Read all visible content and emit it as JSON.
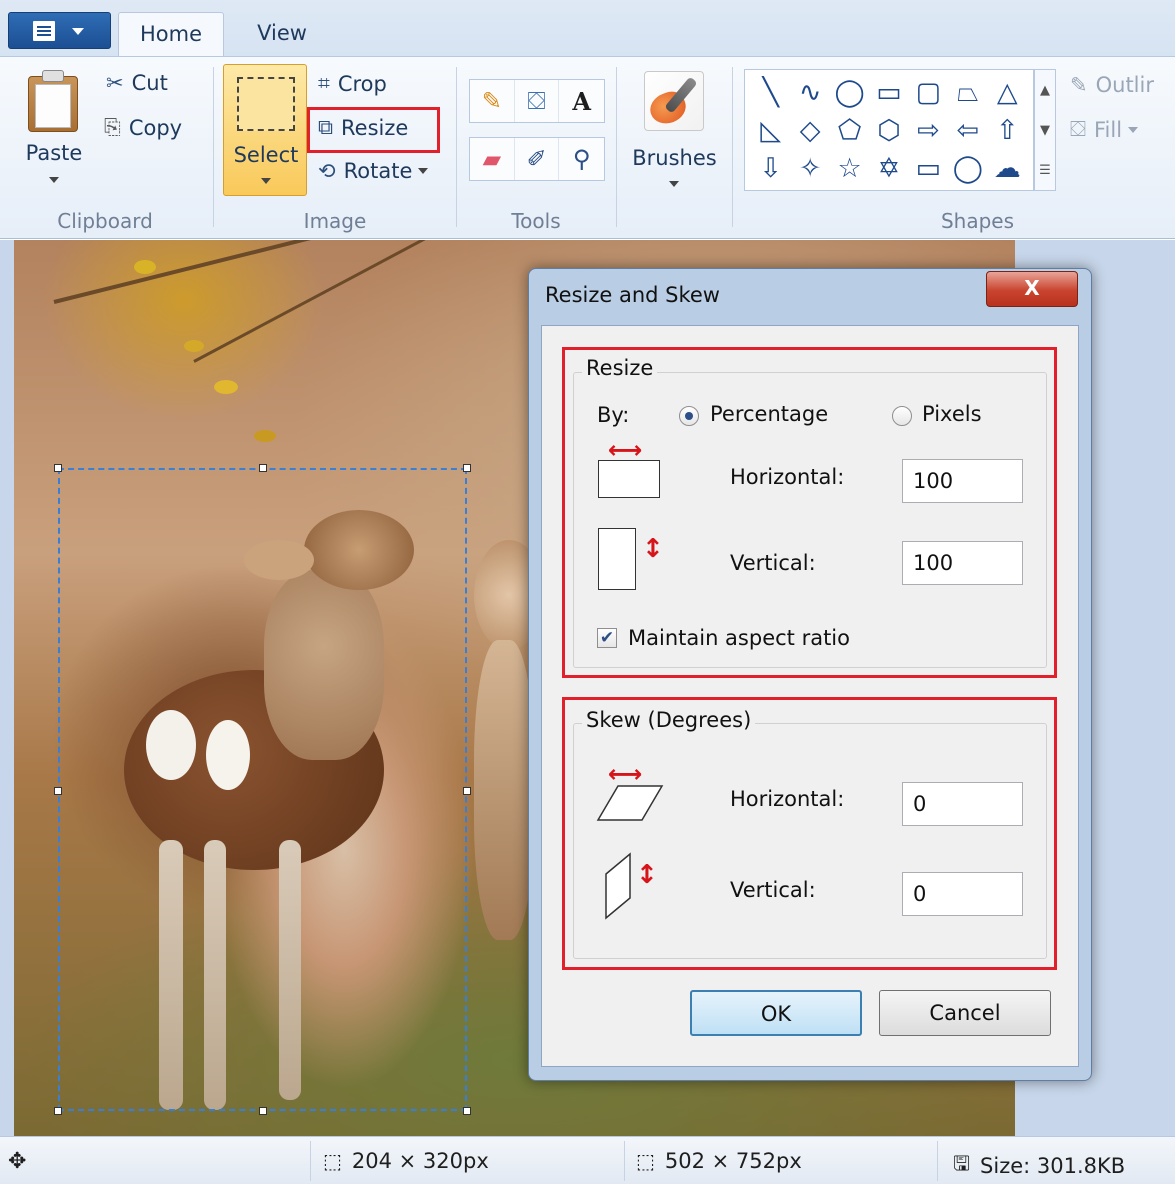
{
  "tabs": {
    "home": "Home",
    "view": "View"
  },
  "ribbon": {
    "clipboard": {
      "label": "Clipboard",
      "paste": "Paste",
      "cut": "Cut",
      "copy": "Copy"
    },
    "image": {
      "label": "Image",
      "select": "Select",
      "crop": "Crop",
      "resize": "Resize",
      "rotate": "Rotate"
    },
    "tools": {
      "label": "Tools"
    },
    "brushes": {
      "label": "Brushes"
    },
    "shapes": {
      "label": "Shapes",
      "outline": "Outlir",
      "fill": "Fill"
    }
  },
  "dialog": {
    "title": "Resize and Skew",
    "close": "X",
    "resize": {
      "legend": "Resize",
      "by_label": "By:",
      "percentage": "Percentage",
      "pixels": "Pixels",
      "selected": "Percentage",
      "horizontal_label": "Horizontal:",
      "horizontal_value": "100",
      "vertical_label": "Vertical:",
      "vertical_value": "100",
      "maintain_aspect": "Maintain aspect ratio",
      "maintain_aspect_checked": true
    },
    "skew": {
      "legend": "Skew (Degrees)",
      "horizontal_label": "Horizontal:",
      "horizontal_value": "0",
      "vertical_label": "Vertical:",
      "vertical_value": "0"
    },
    "ok": "OK",
    "cancel": "Cancel"
  },
  "status": {
    "selection_size": "204 × 320px",
    "image_size": "502 × 752px",
    "file_size": "Size: 301.8KB"
  },
  "colors": {
    "highlight": "#e2202b",
    "accent": "#1c4f93"
  }
}
